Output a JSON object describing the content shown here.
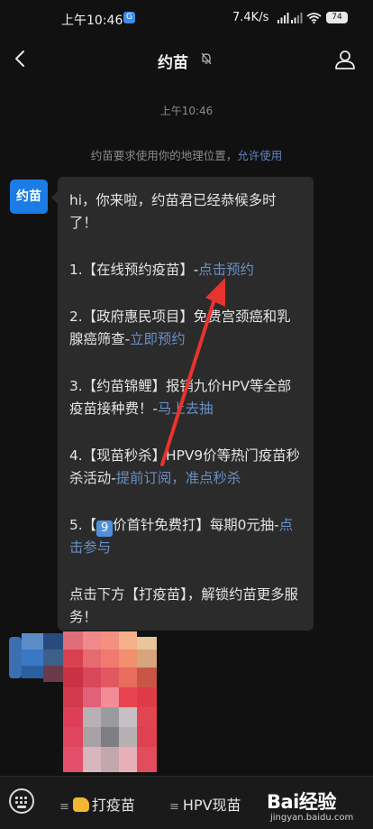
{
  "status_bar": {
    "time": "上午10:46",
    "sim_badge": "G",
    "net_speed": "7.4K/s",
    "battery": "74"
  },
  "header": {
    "title": "约苗",
    "back_icon": "chevron-left-icon",
    "mute_icon": "bell-off-icon",
    "profile_icon": "user-icon"
  },
  "chat": {
    "timestamp": "上午10:46",
    "location_prompt": "约苗要求使用你的地理位置，",
    "location_link": "允许使用",
    "avatar_label": "约苗",
    "greeting": "hi，你来啦，约苗君已经恭候多时了！",
    "items": [
      {
        "prefix": "1.【在线预约疫苗】-",
        "link": "点击预约"
      },
      {
        "prefix": "2.【政府惠民项目】免费宫颈癌和乳腺癌筛查-",
        "link": "立即预约"
      },
      {
        "prefix": "3.【约苗锦鲤】报销九价HPV等全部疫苗接种费！-",
        "link": "马上去抽"
      },
      {
        "prefix": "4.【现苗秒杀】HPV9价等热门疫苗秒杀活动-",
        "link": "提前订阅，准点秒杀"
      },
      {
        "prefix_a": "5.【",
        "emoji": "9",
        "prefix_b": "价首针免费打】每期0元抽-",
        "link": "点击参与"
      }
    ],
    "footer": "点击下方【打疫苗】，解锁约苗更多服务！"
  },
  "bottom_bar": {
    "keyboard_icon": "keyboard-icon",
    "menu1": "打疫苗",
    "menu2": "HPV现苗",
    "watermark": "Bai经验",
    "watermark_sub": "jingyan.baidu.com"
  },
  "colors": {
    "background": "#111111",
    "bubble": "#2b2b2b",
    "link": "#6a8fc4",
    "accent_blue": "#1b7ce6",
    "arrow_red": "#e8332e"
  }
}
